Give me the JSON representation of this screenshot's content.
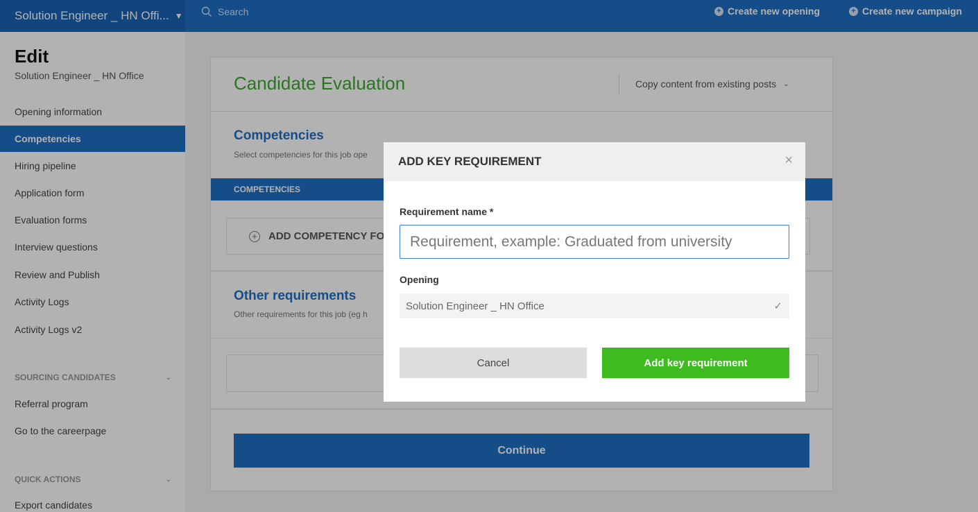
{
  "topbar": {
    "job_title": "Solution Engineer _ HN Offi...",
    "search_placeholder": "Search",
    "create_opening": "Create new opening",
    "create_campaign": "Create new campaign"
  },
  "sidebar": {
    "title": "Edit",
    "subtitle": "Solution Engineer _ HN Office",
    "items": [
      {
        "label": "Opening information"
      },
      {
        "label": "Competencies"
      },
      {
        "label": "Hiring pipeline"
      },
      {
        "label": "Application form"
      },
      {
        "label": "Evaluation forms"
      },
      {
        "label": "Interview questions"
      },
      {
        "label": "Review and Publish"
      },
      {
        "label": "Activity Logs"
      },
      {
        "label": "Activity Logs v2"
      }
    ],
    "active_item": "Competencies",
    "sourcing": {
      "header": "SOURCING CANDIDATES",
      "items": [
        {
          "label": "Referral program"
        },
        {
          "label": "Go to the careerpage"
        }
      ]
    },
    "quick_actions": {
      "header": "QUICK ACTIONS",
      "items": [
        {
          "label": "Export candidates"
        }
      ]
    }
  },
  "main": {
    "title": "Candidate Evaluation",
    "copy_content": "Copy content from existing posts",
    "competencies": {
      "title": "Competencies",
      "description": "Select competencies for this job ope",
      "bar_label": "COMPETENCIES",
      "add_label": "ADD COMPETENCY FOR"
    },
    "other": {
      "title": "Other requirements",
      "description": "Other requirements for this job (eg h"
    },
    "continue_label": "Continue"
  },
  "modal": {
    "title": "ADD KEY REQUIREMENT",
    "close": "×",
    "requirement_label": "Requirement name *",
    "requirement_placeholder": "Requirement, example: Graduated from university",
    "requirement_value": "",
    "opening_label": "Opening",
    "opening_value": "Solution Engineer _ HN Office",
    "cancel_label": "Cancel",
    "submit_label": "Add key requirement"
  },
  "colors": {
    "primary": "#1f6fc4",
    "success": "#3dbb1f",
    "heading_green": "#3da82d"
  }
}
